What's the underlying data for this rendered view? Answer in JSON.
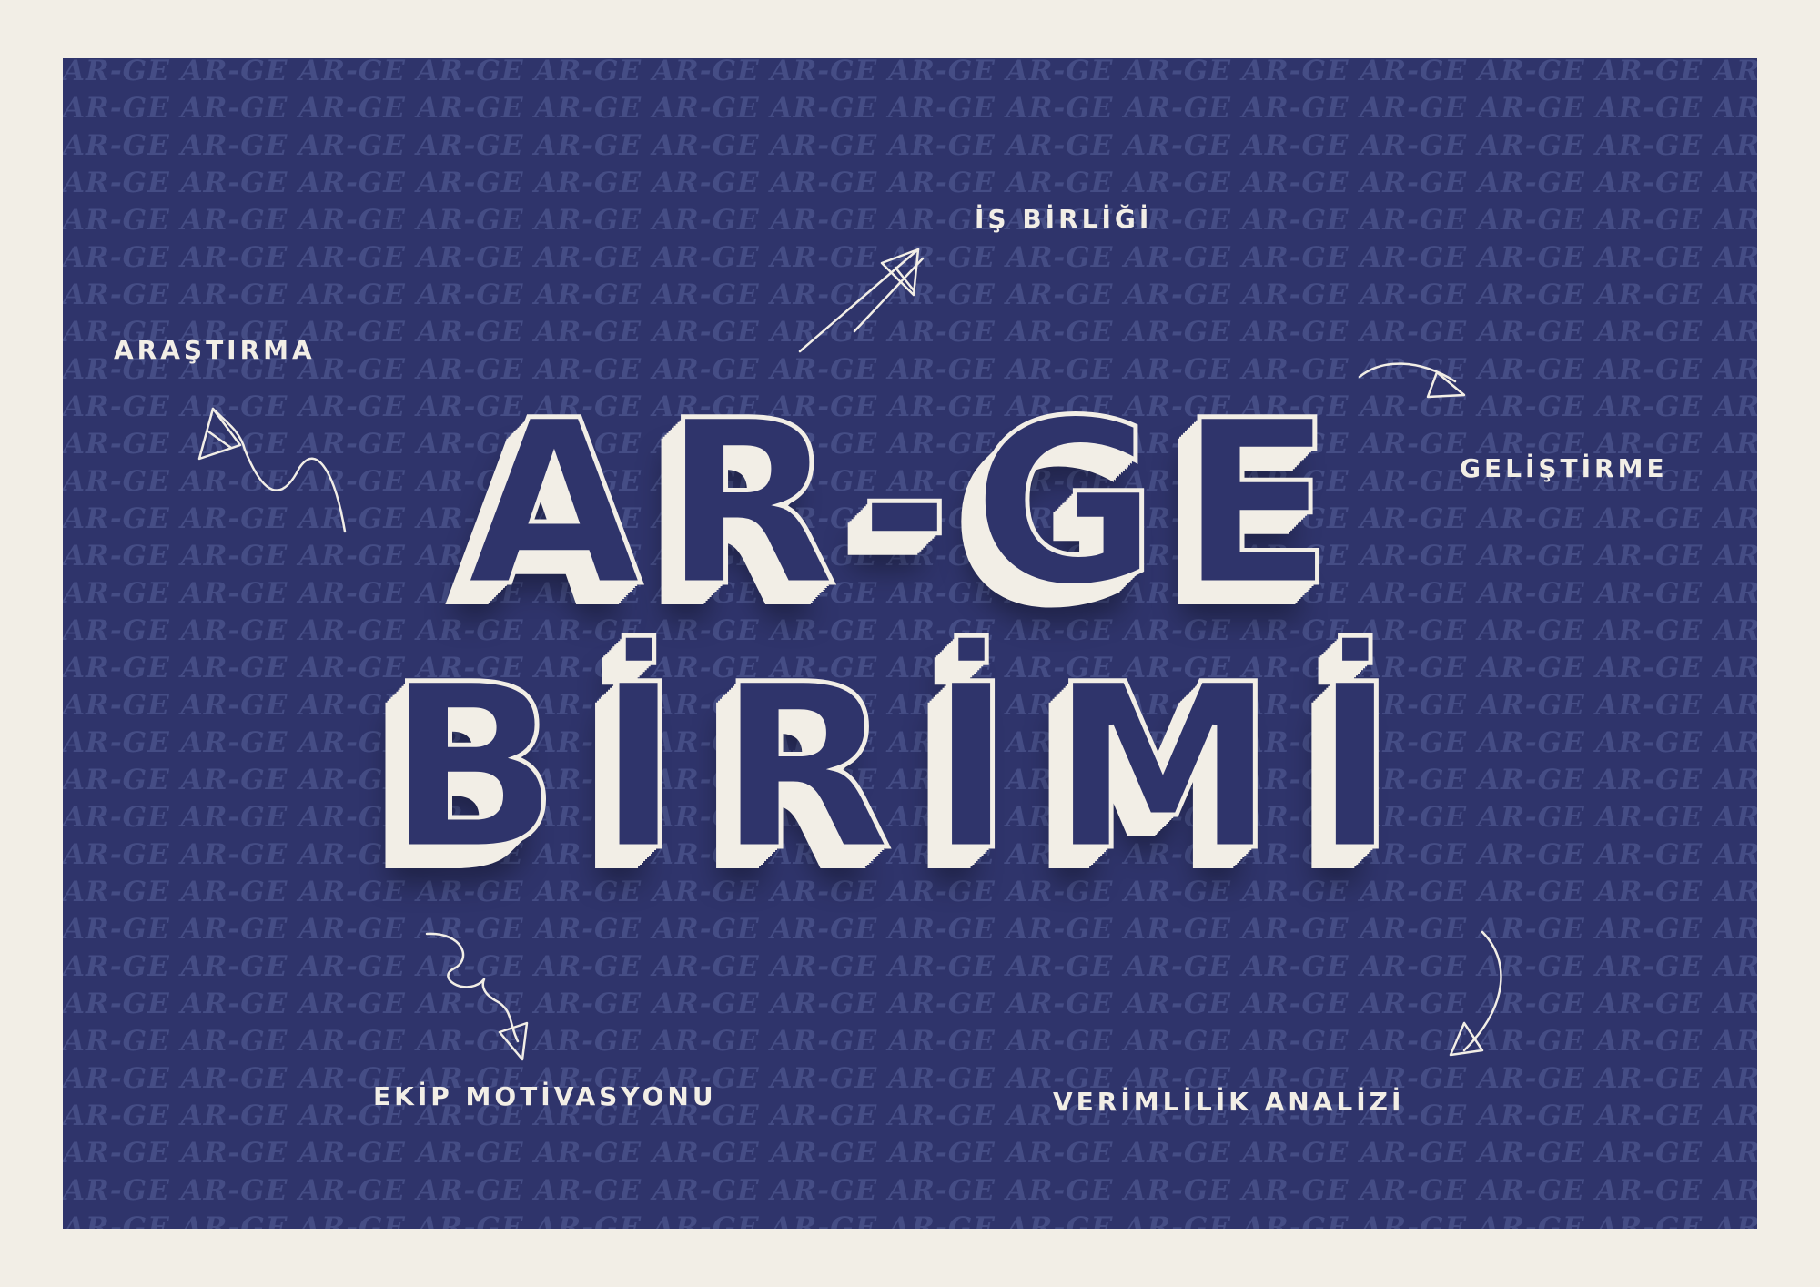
{
  "background_pattern_word": "AR-GE",
  "title": {
    "line1": "AR-GE",
    "line2": "BİRİMİ"
  },
  "labels": {
    "top": "İŞ BİRLİĞİ",
    "left": "ARAŞTIRMA",
    "right": "GELİŞTİRME",
    "bottom_left": "EKİP MOTİVASYONU",
    "bottom_right": "VERİMLİLİK ANALİZİ"
  },
  "colors": {
    "background": "#f2eee6",
    "card": "#2f346b",
    "pattern": "#454d85",
    "text": "#f2eee6"
  }
}
